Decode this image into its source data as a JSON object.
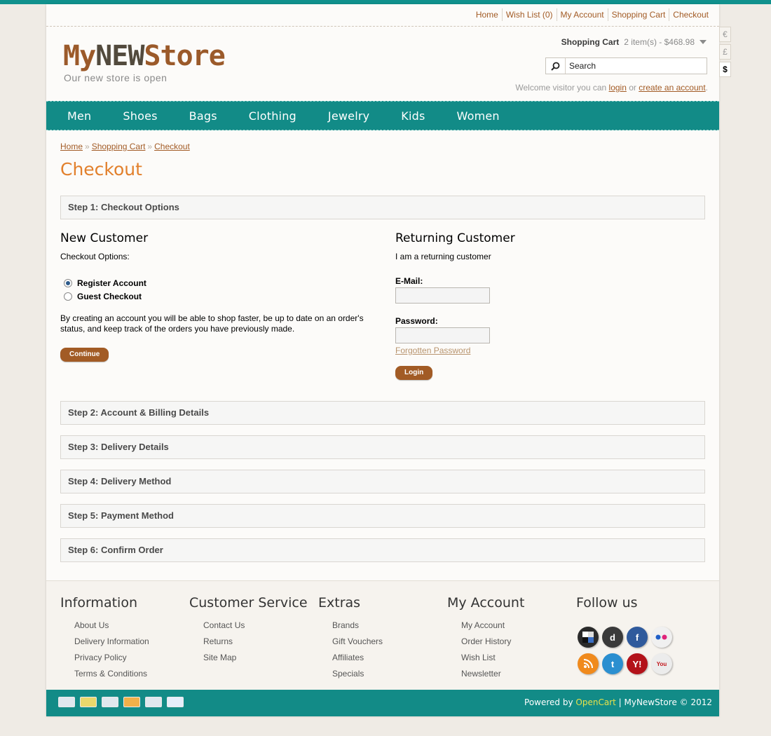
{
  "top_links": [
    "Home",
    "Wish List (0)",
    "My Account",
    "Shopping Cart",
    "Checkout"
  ],
  "logo": {
    "part1": "My",
    "part2": "NEW",
    "part3": "Store",
    "tagline": "Our new store is open"
  },
  "cart": {
    "label": "Shopping Cart",
    "value": "2 item(s) - $468.98"
  },
  "search": {
    "value": "Search"
  },
  "welcome": {
    "prefix": "Welcome visitor you can ",
    "login": "login",
    "middle": " or ",
    "create": "create an account",
    "suffix": "."
  },
  "currency": [
    "€",
    "£",
    "$"
  ],
  "nav": [
    "Men",
    "Shoes",
    "Bags",
    "Clothing",
    "Jewelry",
    "Kids",
    "Women"
  ],
  "breadcrumb": [
    "Home",
    "Shopping Cart",
    "Checkout"
  ],
  "breadcrumb_sep": "»",
  "page_title": "Checkout",
  "steps": [
    "Step 1: Checkout Options",
    "Step 2: Account & Billing Details",
    "Step 3: Delivery Details",
    "Step 4: Delivery Method",
    "Step 5: Payment Method",
    "Step 6: Confirm Order"
  ],
  "new_customer": {
    "title": "New Customer",
    "options_label": "Checkout Options:",
    "register": "Register Account",
    "guest": "Guest Checkout",
    "description": "By creating an account you will be able to shop faster, be up to date on an order's status, and keep track of the orders you have previously made.",
    "continue": "Continue"
  },
  "returning_customer": {
    "title": "Returning Customer",
    "subtitle": "I am a returning customer",
    "email_label": "E-Mail:",
    "password_label": "Password:",
    "forgotten": "Forgotten Password",
    "login": "Login"
  },
  "footer": {
    "information": {
      "title": "Information",
      "links": [
        "About Us",
        "Delivery Information",
        "Privacy Policy",
        "Terms & Conditions"
      ]
    },
    "customer_service": {
      "title": "Customer Service",
      "links": [
        "Contact Us",
        "Returns",
        "Site Map"
      ]
    },
    "extras": {
      "title": "Extras",
      "links": [
        "Brands",
        "Gift Vouchers",
        "Affiliates",
        "Specials"
      ]
    },
    "my_account": {
      "title": "My Account",
      "links": [
        "My Account",
        "Order History",
        "Wish List",
        "Newsletter"
      ]
    },
    "follow_us": {
      "title": "Follow us"
    }
  },
  "social_icons": [
    "delicious-icon",
    "digg-icon",
    "facebook-icon",
    "flickr-icon",
    "rss-icon",
    "twitter-icon",
    "yahoo-icon",
    "youtube-icon"
  ],
  "powered": {
    "prefix": "Powered by ",
    "brand": "OpenCart",
    "suffix": " | MyNewStore © 2012"
  },
  "colors": {
    "accent": "#128b87",
    "brand": "#a25b25",
    "title": "#e2802c"
  }
}
